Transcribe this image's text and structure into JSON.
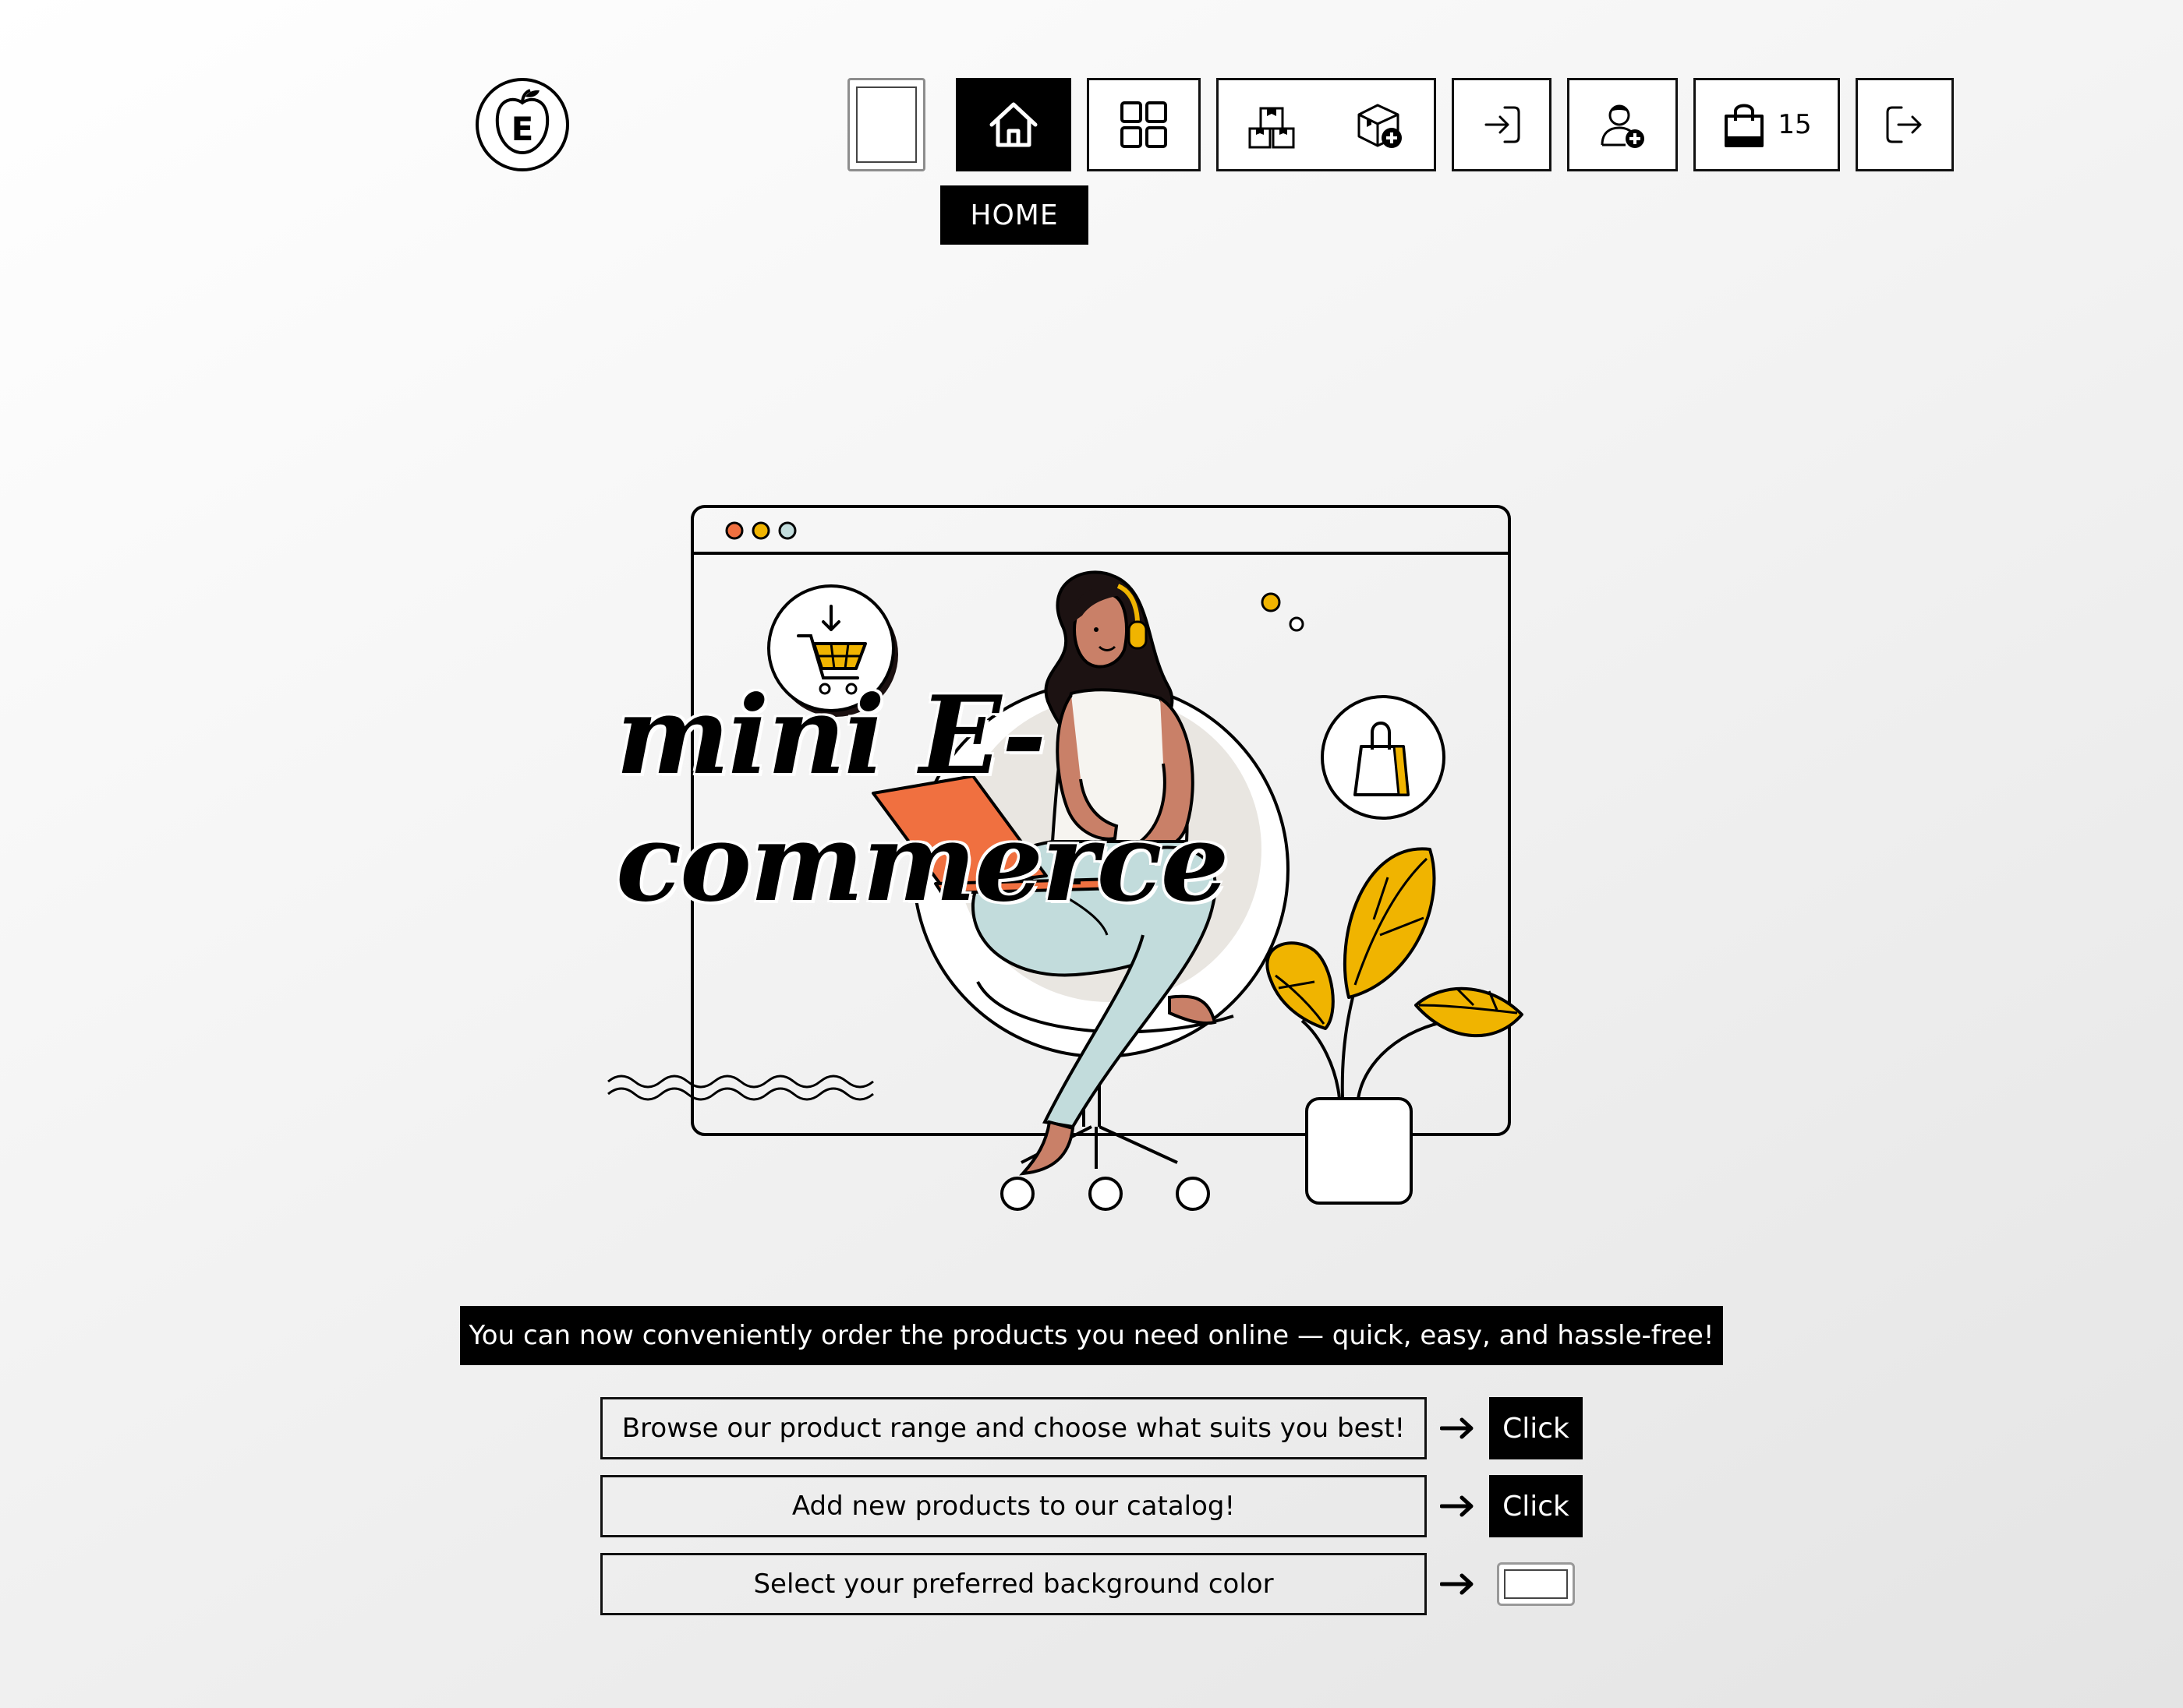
{
  "header": {
    "logo_letter": "E",
    "tooltip": "HOME",
    "cart_count": "15",
    "nav": [
      {
        "name": "home",
        "icon": "home-icon"
      },
      {
        "name": "catalog",
        "icon": "grid-icon"
      },
      {
        "name": "products",
        "icon": "boxes-icon"
      },
      {
        "name": "add-product",
        "icon": "box-plus-icon"
      },
      {
        "name": "login",
        "icon": "login-icon"
      },
      {
        "name": "register",
        "icon": "user-plus-icon"
      },
      {
        "name": "cart",
        "icon": "shopping-bag-icon"
      },
      {
        "name": "logout",
        "icon": "logout-icon"
      }
    ]
  },
  "hero": {
    "title": "mini E-commerce"
  },
  "main": {
    "tagline": "You can now conveniently order the products you need online — quick, easy, and hassle-free!",
    "rows": [
      {
        "label": "Browse our product range and choose what suits you best!",
        "action": "Click"
      },
      {
        "label": "Add new products to our catalog!",
        "action": "Click"
      },
      {
        "label": "Select your preferred background color",
        "action": ""
      }
    ]
  },
  "colors": {
    "accent_orange": "#f07040",
    "accent_yellow": "#f0b400",
    "pants": "#c2dcdc",
    "skin": "#c98068"
  }
}
